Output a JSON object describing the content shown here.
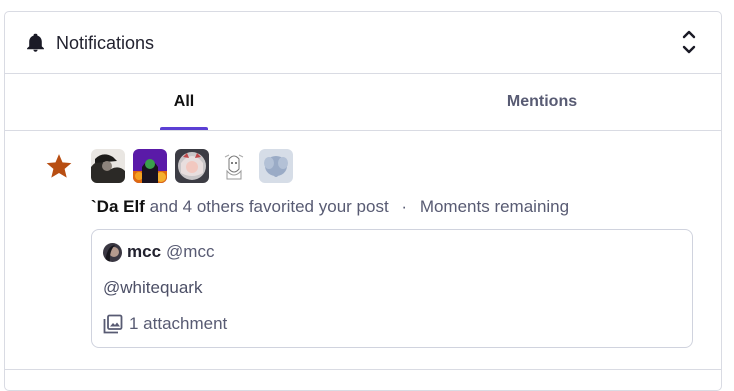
{
  "header": {
    "title": "Notifications",
    "icon": "bell-icon",
    "toggle_icon": "collapse-toggle-icon"
  },
  "tabs": [
    {
      "label": "All",
      "active": true
    },
    {
      "label": "Mentions",
      "active": false
    }
  ],
  "accent_color": "#5b3fd4",
  "notification": {
    "type_icon": "star-icon",
    "type_icon_color": "#b84e12",
    "actor": "`Da Elf",
    "action": "and 4 others favorited your post",
    "separator": "·",
    "time": "Moments remaining",
    "status": {
      "display_name": "mcc",
      "acct": "@mcc",
      "content": "@whitequark",
      "attachment_icon": "image-gallery-icon",
      "attachment_label": "1 attachment"
    }
  }
}
